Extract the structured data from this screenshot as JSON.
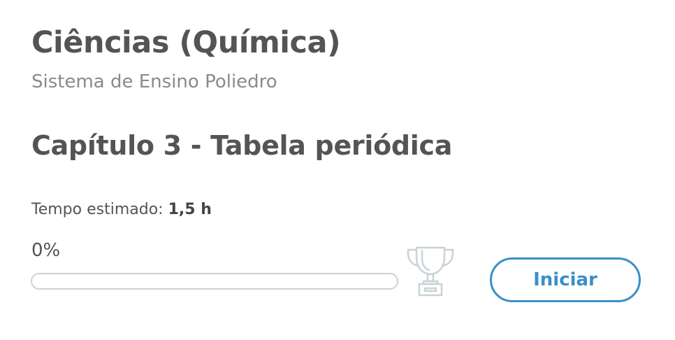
{
  "course": {
    "title": "Ciências (Química)",
    "subtitle": "Sistema de Ensino Poliedro"
  },
  "chapter": {
    "title": "Capítulo 3 - Tabela periódica"
  },
  "estimated_time": {
    "label": "Tempo estimado:",
    "value": "1,5 h"
  },
  "progress": {
    "text": "0%",
    "value": 0
  },
  "icons": {
    "completion": "trophy-icon"
  },
  "actions": {
    "start_label": "Iniciar"
  },
  "colors": {
    "accent": "#3a8fc8",
    "text_primary": "#545454",
    "text_secondary": "#8a8a8a",
    "progress_border": "#c9d2d6",
    "trophy": "#c9d2d6"
  }
}
